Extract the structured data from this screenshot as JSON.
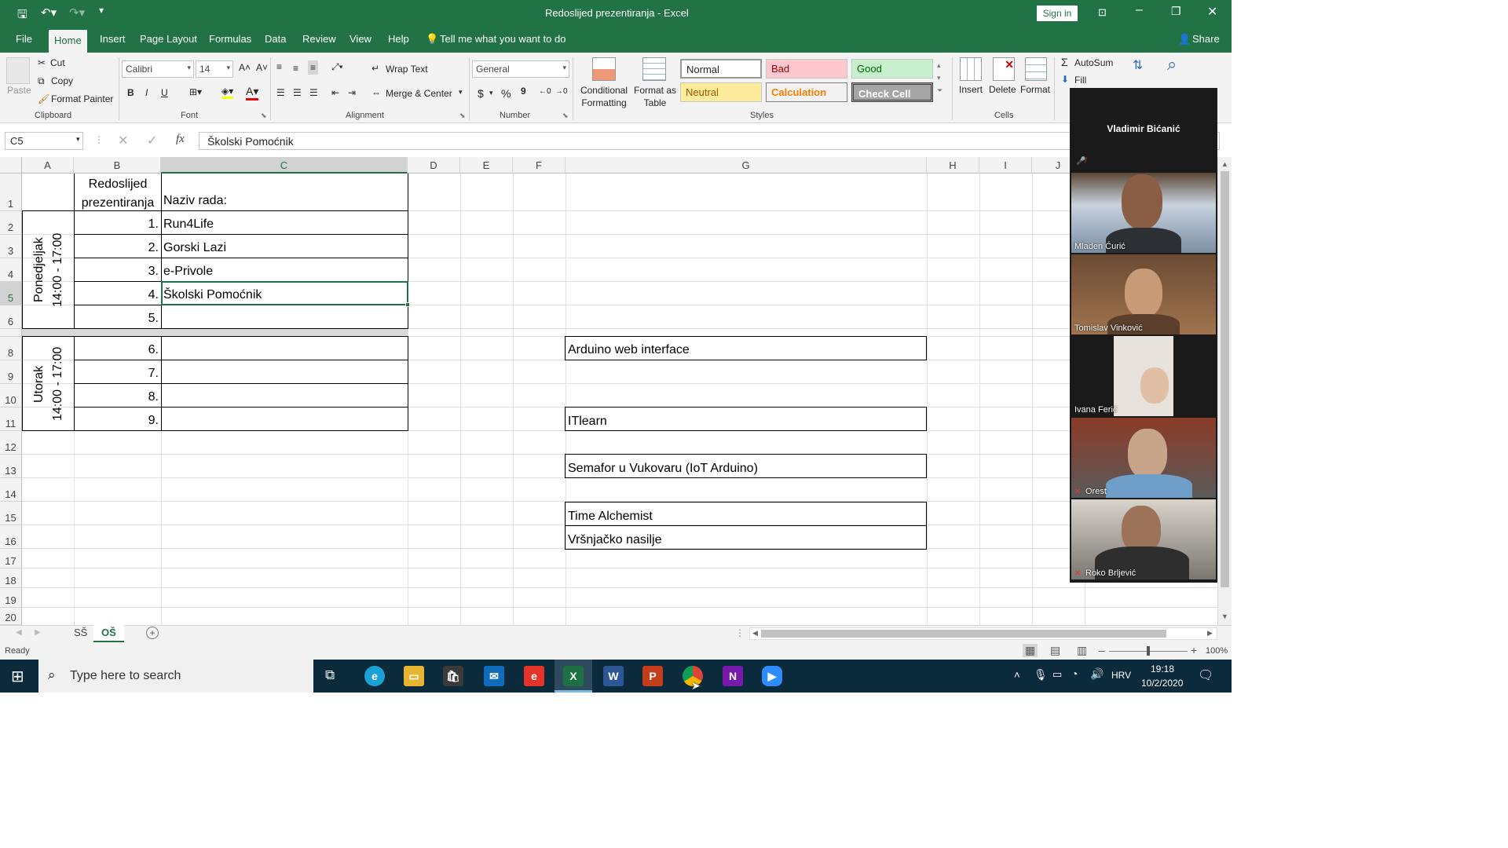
{
  "titlebar": {
    "title": "Redoslijed prezentiranja  -  Excel",
    "signin": "Sign in"
  },
  "tabs": [
    "File",
    "Home",
    "Insert",
    "Page Layout",
    "Formulas",
    "Data",
    "Review",
    "View",
    "Help"
  ],
  "tell_me": "Tell me what you want to do",
  "share": "Share",
  "clipboard": {
    "paste": "Paste",
    "cut": "Cut",
    "copy": "Copy",
    "format_painter": "Format Painter",
    "label": "Clipboard"
  },
  "font": {
    "name": "Calibri",
    "size": "14",
    "label": "Font",
    "bold": "B",
    "italic": "I",
    "underline": "U"
  },
  "alignment": {
    "wrap": "Wrap Text",
    "merge": "Merge & Center",
    "label": "Alignment"
  },
  "number": {
    "format": "General",
    "label": "Number",
    "currency": "$",
    "percent": "%",
    "comma": "9"
  },
  "styles": {
    "conditional": "Conditional Formatting",
    "format_table": "Format as Table",
    "normal": "Normal",
    "bad": "Bad",
    "good": "Good",
    "neutral": "Neutral",
    "calculation": "Calculation",
    "check": "Check Cell",
    "label": "Styles"
  },
  "cells": {
    "insert": "Insert",
    "delete": "Delete",
    "format": "Format",
    "label": "Cells"
  },
  "editing": {
    "autosum": "AutoSum",
    "fill": "Fill"
  },
  "formula_bar": {
    "name_box": "C5",
    "fx": "fx",
    "value": "Školski Pomoćnik"
  },
  "columns": [
    "A",
    "B",
    "C",
    "D",
    "E",
    "F",
    "G",
    "H",
    "I",
    "J"
  ],
  "rows": [
    "1",
    "2",
    "3",
    "4",
    "5",
    "6",
    "8",
    "9",
    "10",
    "11",
    "12",
    "13",
    "14",
    "15",
    "16",
    "17",
    "18",
    "19",
    "20"
  ],
  "table": {
    "header_b": [
      "Redoslijed",
      "prezentiranja"
    ],
    "header_c": "Naziv rada:",
    "entries": [
      {
        "n": "1.",
        "name": "Run4Life"
      },
      {
        "n": "2.",
        "name": "Gorski Lazi"
      },
      {
        "n": "3.",
        "name": "e-Privole"
      },
      {
        "n": "4.",
        "name": "Školski Pomoćnik"
      },
      {
        "n": "5.",
        "name": ""
      },
      {
        "n": "6.",
        "name": ""
      },
      {
        "n": "7.",
        "name": ""
      },
      {
        "n": "8.",
        "name": ""
      },
      {
        "n": "9.",
        "name": ""
      }
    ],
    "day1": [
      "Ponedjeljak",
      "14:00 - 17:00"
    ],
    "day2": [
      "Utorak",
      "14:00 - 17:00"
    ]
  },
  "column_g": [
    "Arduino web interface",
    "ITlearn",
    "Semafor u Vukovaru (IoT Arduino)",
    "Time Alchemist",
    "Vršnjačko nasilje"
  ],
  "sheets": [
    "SŠ",
    "OŠ"
  ],
  "status": {
    "ready": "Ready",
    "zoom": "100%"
  },
  "video": {
    "host": "Vladimir Bićanić",
    "participants": [
      "Mladen Ćurić",
      "Tomislav Vinković",
      "Ivana Ferić",
      "Orest",
      "Roko Brljević"
    ]
  },
  "taskbar": {
    "search": "Type here to search",
    "lang": "HRV",
    "time": "19:18",
    "date": "10/2/2020"
  }
}
